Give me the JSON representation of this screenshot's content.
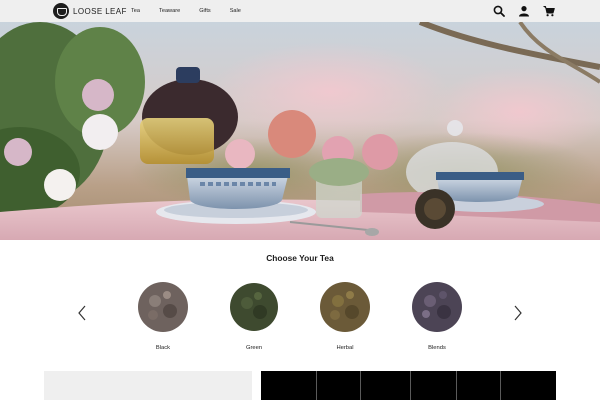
{
  "brand": {
    "name": "LOOSE LEAF",
    "logo_icon": "teacup-logo-icon"
  },
  "nav": {
    "items": [
      {
        "label": "Tea"
      },
      {
        "label": "Teaware"
      },
      {
        "label": "Gifts"
      },
      {
        "label": "Sale"
      }
    ]
  },
  "header_icons": [
    "search-icon",
    "account-icon",
    "cart-icon"
  ],
  "hero": {
    "description_icon": "tea-table-scene-image"
  },
  "tea_section": {
    "title": "Choose Your Tea",
    "items": [
      {
        "label": "Black",
        "color": "#6e625e"
      },
      {
        "label": "Green",
        "color": "#3e4a2f"
      },
      {
        "label": "Herbal",
        "color": "#6b5a38"
      },
      {
        "label": "Blends",
        "color": "#4c4455"
      }
    ]
  },
  "colors": {
    "header_bg": "#efefef",
    "tablecloth": "#e3bcc3",
    "dark_tile": "#000000",
    "light_tile": "#efefef"
  }
}
